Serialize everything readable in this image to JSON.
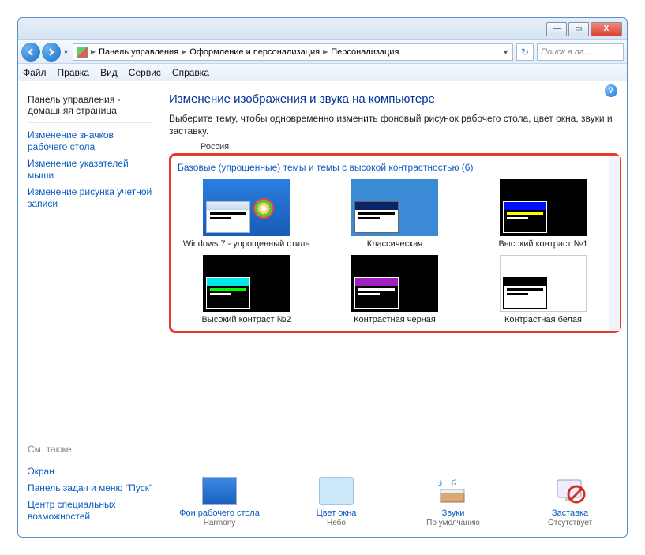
{
  "window": {
    "minimize": "—",
    "maximize": "▭",
    "close": "X"
  },
  "breadcrumbs": {
    "item1": "Панель управления",
    "item2": "Оформление и персонализация",
    "item3": "Персонализация"
  },
  "search": {
    "placeholder": "Поиск в па..."
  },
  "menu": {
    "file": "Файл",
    "edit": "Правка",
    "view": "Вид",
    "service": "Сервис",
    "help": "Справка"
  },
  "sidebar": {
    "home": "Панель управления - домашняя страница",
    "link1": "Изменение значков рабочего стола",
    "link2": "Изменение указателей мыши",
    "link3": "Изменение рисунка учетной записи",
    "see_also": "См. также",
    "also1": "Экран",
    "also2": "Панель задач и меню \"Пуск\"",
    "also3": "Центр специальных возможностей"
  },
  "content": {
    "heading": "Изменение изображения и звука на компьютере",
    "desc": "Выберите тему, чтобы одновременно изменить фоновый рисунок рабочего стола, цвет окна, звуки и заставку.",
    "russia": "Россия",
    "section_title": "Базовые (упрощенные) темы и темы с высокой контрастностью (6)",
    "themes": {
      "t1": "Windows 7 - упрощенный стиль",
      "t2": "Классическая",
      "t3": "Высокий контраст №1",
      "t4": "Высокий контраст №2",
      "t5": "Контрастная черная",
      "t6": "Контрастная белая"
    }
  },
  "bottom": {
    "b1": {
      "label": "Фон рабочего стола",
      "sub": "Harmony"
    },
    "b2": {
      "label": "Цвет окна",
      "sub": "Небо"
    },
    "b3": {
      "label": "Звуки",
      "sub": "По умолчанию"
    },
    "b4": {
      "label": "Заставка",
      "sub": "Отсутствует"
    }
  },
  "help": "?"
}
